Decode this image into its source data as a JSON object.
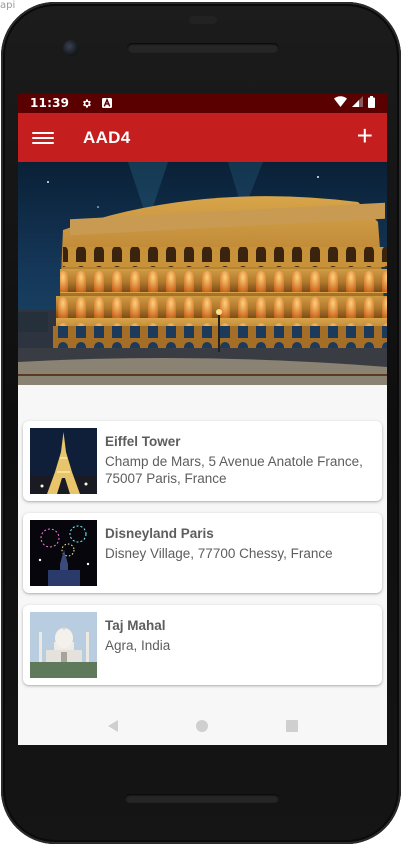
{
  "corner_text": "api",
  "status_bar": {
    "time": "11:39",
    "icons": [
      "gear-icon",
      "a-badge-icon",
      "wifi-icon",
      "signal-icon",
      "battery-icon"
    ]
  },
  "app_bar": {
    "title": "AAD4",
    "menu_icon": "hamburger-menu-icon",
    "add_icon": "plus-icon",
    "add_label": "+",
    "color": "#c41e1e"
  },
  "hero": {
    "image": "colosseum-night-photo"
  },
  "places": [
    {
      "name": "Eiffel Tower",
      "address": "Champ de Mars, 5 Avenue Anatole France, 75007 Paris, France",
      "image": "eiffel-tower-night-photo"
    },
    {
      "name": "Disneyland Paris",
      "address": "Disney Village, 77700 Chessy, France",
      "image": "disneyland-fireworks-photo"
    },
    {
      "name": "Taj Mahal",
      "address": "Agra, India",
      "image": "taj-mahal-photo"
    }
  ],
  "nav_bar": {
    "icons": [
      "back-triangle-icon",
      "home-circle-icon",
      "recents-square-icon"
    ]
  },
  "colors": {
    "status_bar": "#5a0000",
    "app_bar": "#c41e1e",
    "background": "#f7f7f7"
  }
}
